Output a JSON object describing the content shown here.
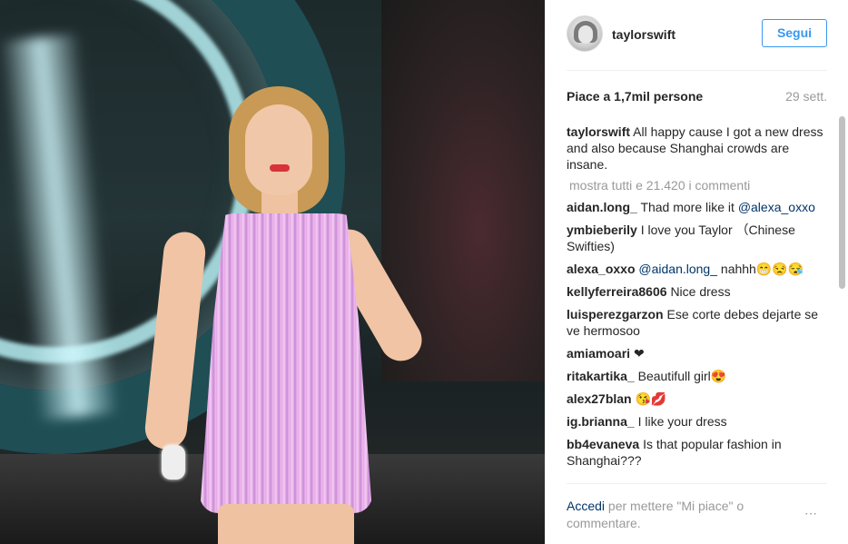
{
  "post": {
    "username": "taylorswift",
    "follow_label": "Segui",
    "likes": "Piace a 1,7mil persone",
    "date": "29 sett.",
    "caption": {
      "user": "taylorswift",
      "text": "All happy cause I got a new dress and also because Shanghai crowds are insane."
    },
    "show_all_comments": "mostra tutti e 21.420 i commenti",
    "comments": [
      {
        "user": "aidan.long_",
        "text": "Thad more like it",
        "mention": "@alexa_oxxo",
        "after": ""
      },
      {
        "user": "ymbieberily",
        "text": "I love you Taylor （Chinese Swifties)",
        "mention": "",
        "after": ""
      },
      {
        "user": "alexa_oxxo",
        "text": "",
        "mention": "@aidan.long_",
        "after": "nahhh😁😒😪"
      },
      {
        "user": "kellyferreira8606",
        "text": "Nice dress",
        "mention": "",
        "after": ""
      },
      {
        "user": "luisperezgarzon",
        "text": "Ese corte debes dejarte se ve hermosoo",
        "mention": "",
        "after": ""
      },
      {
        "user": "amiamoari",
        "text": "❤",
        "mention": "",
        "after": ""
      },
      {
        "user": "ritakartika_",
        "text": "Beautifull girl😍",
        "mention": "",
        "after": ""
      },
      {
        "user": "alex27blan",
        "text": "😘💋",
        "mention": "",
        "after": ""
      },
      {
        "user": "ig.brianna_",
        "text": "I like your dress",
        "mention": "",
        "after": ""
      },
      {
        "user": "bb4evaneva",
        "text": "Is that popular fashion in Shanghai???",
        "mention": "",
        "after": ""
      }
    ],
    "footer": {
      "login_link": "Accedi",
      "login_text": "per mettere \"Mi piace\" o commentare.",
      "more_icon": "⋯"
    }
  },
  "colors": {
    "accent": "#3897f0",
    "link": "#003569",
    "muted": "#999999",
    "text": "#262626"
  }
}
